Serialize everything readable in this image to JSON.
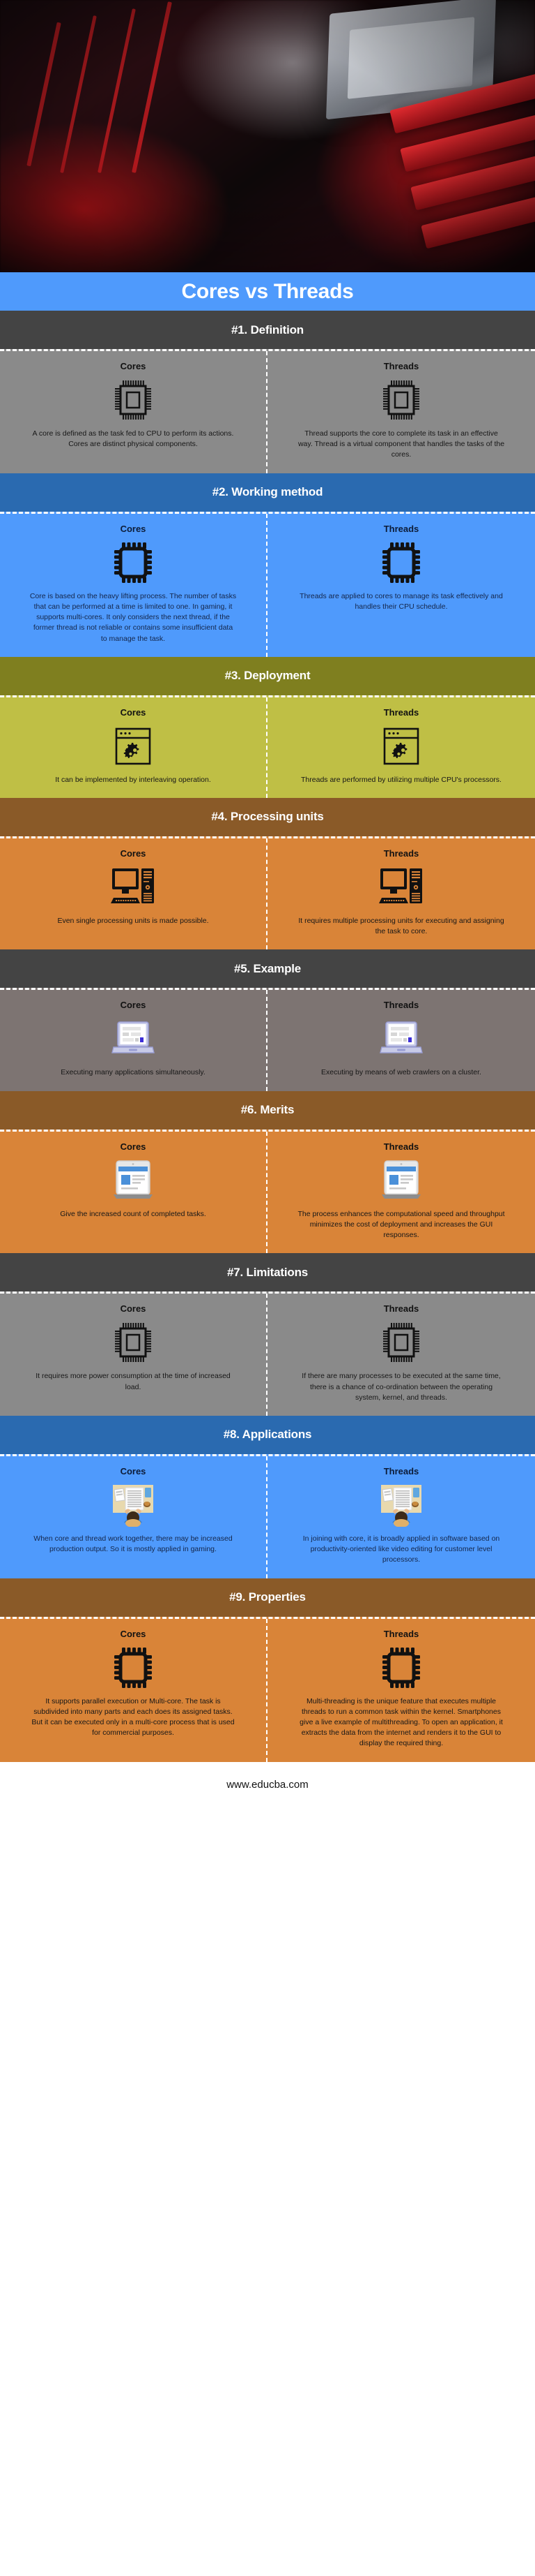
{
  "title": "Cores vs Threads",
  "footer": {
    "url": "www.educba.com"
  },
  "colors": {
    "title_band": "#4f9afc",
    "dark_header": "#444444",
    "gray_body": "#8a8a8a",
    "blue_header": "#2a6ab0",
    "blue_body": "#4f9afc",
    "olive_header": "#7f7f1f",
    "olive_body": "#bfbf45",
    "brown_header": "#8a5a28",
    "orange_body": "#d98438",
    "example_header": "#444444",
    "example_body": "#7d7472",
    "footer_text": "#111111"
  },
  "column_labels": {
    "left": "Cores",
    "right": "Threads"
  },
  "sections": [
    {
      "header": "#1. Definition",
      "header_color": "#444444",
      "body_color": "#8a8a8a",
      "icon": "cpu-chip-icon",
      "left": {
        "label": "Cores",
        "text": "A core is defined as the task fed to CPU to perform its actions. Cores are distinct physical components."
      },
      "right": {
        "label": "Threads",
        "text": "Thread supports the core to complete its task in an effective way. Thread is a virtual component that handles the tasks of the cores."
      }
    },
    {
      "header": "#2. Working method",
      "header_color": "#2a6ab0",
      "body_color": "#4f9afc",
      "icon": "microchip-icon",
      "left": {
        "label": "Cores",
        "text": "Core is based on the heavy lifting process. The number of tasks that can be performed at a time is limited to one. In gaming, it supports multi-cores. It only considers the next thread, if the former thread is not reliable or contains some insufficient data to manage the task."
      },
      "right": {
        "label": "Threads",
        "text": "Threads are applied to cores to manage its task effectively and handles their CPU schedule."
      }
    },
    {
      "header": "#3. Deployment",
      "header_color": "#7f7f1f",
      "body_color": "#bfbf45",
      "icon": "browser-gears-icon",
      "left": {
        "label": "Cores",
        "text": "It can be implemented by interleaving operation."
      },
      "right": {
        "label": "Threads",
        "text": "Threads are performed by utilizing multiple CPU's processors."
      }
    },
    {
      "header": "#4. Processing units",
      "header_color": "#8a5a28",
      "body_color": "#d98438",
      "icon": "desktop-tower-icon",
      "left": {
        "label": "Cores",
        "text": "Even single processing units is made possible."
      },
      "right": {
        "label": "Threads",
        "text": "It requires multiple processing units for executing and assigning the task to core."
      }
    },
    {
      "header": "#5. Example",
      "header_color": "#444444",
      "body_color": "#7d7472",
      "icon": "laptop-window-icon",
      "left": {
        "label": "Cores",
        "text": "Executing many applications simultaneously."
      },
      "right": {
        "label": "Threads",
        "text": "Executing by means of web crawlers on a cluster."
      }
    },
    {
      "header": "#6. Merits",
      "header_color": "#8a5a28",
      "body_color": "#d98438",
      "icon": "tablet-document-icon",
      "left": {
        "label": "Cores",
        "text": "Give the increased count of completed tasks."
      },
      "right": {
        "label": "Threads",
        "text": "The process enhances the computational speed and throughput minimizes the cost of deployment and increases the GUI responses."
      }
    },
    {
      "header": "#7. Limitations",
      "header_color": "#444444",
      "body_color": "#8a8a8a",
      "icon": "cpu-chip-icon",
      "left": {
        "label": "Cores",
        "text": "It requires more power consumption at the time of increased load."
      },
      "right": {
        "label": "Threads",
        "text": "If there are many processes to be executed at the same time, there is a chance of co-ordination between the operating system, kernel, and threads."
      }
    },
    {
      "header": "#8. Applications",
      "header_color": "#2a6ab0",
      "body_color": "#4f9afc",
      "icon": "person-desk-icon",
      "left": {
        "label": "Cores",
        "text": "When core and thread work together, there may be increased production output. So it is mostly applied in gaming."
      },
      "right": {
        "label": "Threads",
        "text": "In joining with core, it is broadly applied in software based on productivity-oriented like video editing for customer level processors."
      }
    },
    {
      "header": "#9. Properties",
      "header_color": "#8a5a28",
      "body_color": "#d98438",
      "icon": "microchip-icon",
      "left": {
        "label": "Cores",
        "text": "It supports parallel execution or Multi-core. The task is subdivided into many parts and each does its assigned tasks. But it can be executed only in a multi-core process that is used for commercial purposes."
      },
      "right": {
        "label": "Threads",
        "text": "Multi-threading is the unique feature that executes multiple threads to run a common task within the kernel. Smartphones give a live example of multithreading. To open an application, it extracts the data from the internet and renders it to the GUI to display the required thing."
      }
    }
  ]
}
